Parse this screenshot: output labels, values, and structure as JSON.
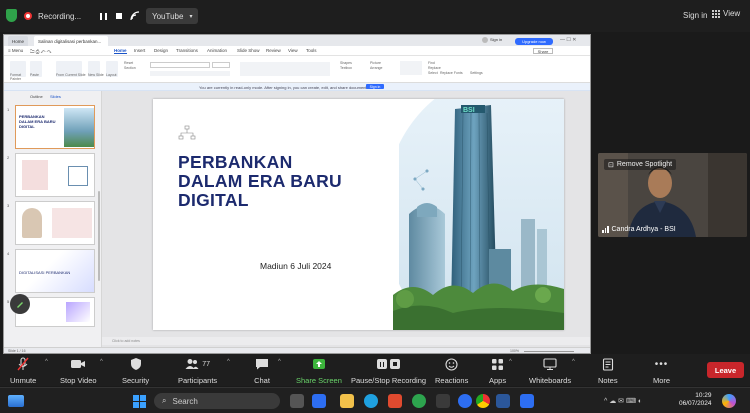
{
  "topbar": {
    "recording_label": "Recording...",
    "youtube_label": "YouTube",
    "signin_label": "Sign in",
    "view_label": "View"
  },
  "wps": {
    "tabs": [
      {
        "label": "Home"
      },
      {
        "label": "Salinan digitalisasi perbankan..."
      }
    ],
    "signin_label": "Sign in",
    "upgrade_label": "Upgrade now",
    "share_label": "Share",
    "menu": {
      "menu_label": "Menu",
      "items": [
        "Home",
        "Insert",
        "Design",
        "Transitions",
        "Animation",
        "Slide Show",
        "Review",
        "View",
        "Tools"
      ],
      "active": "Home"
    },
    "ribbon": {
      "format_painter": "Format Painter",
      "paste": "Paste",
      "from_current_slide": "From Current Slide",
      "new_slide": "New Slide",
      "layout": "Layout",
      "reset": "Reset",
      "section": "Section",
      "shapes": "Shapes",
      "picture": "Picture",
      "textbox": "Textbox",
      "arrange": "Arrange",
      "find": "Find",
      "replace": "Replace",
      "select": "Select",
      "replace_fonts": "Replace Fonts",
      "settings": "Settings"
    },
    "readonly_notice": "You are currently in read-only mode. After signing in, you can create, edit, and share documents.",
    "readonly_signin": "Sign in",
    "panel_tabs": [
      "Outline",
      "Slides"
    ],
    "thumbnails": [
      {
        "num": "1",
        "text": "PERBANKAN DALAM ERA BARU DIGITAL"
      },
      {
        "num": "2",
        "text": ""
      },
      {
        "num": "3",
        "text": ""
      },
      {
        "num": "4",
        "text": "DIGITALISASI PERBANKAN"
      },
      {
        "num": "5",
        "text": ""
      }
    ],
    "slide": {
      "title_line1": "PERBANKAN",
      "title_line2": "DALAM ERA BARU",
      "title_line3": "DIGITAL",
      "date": "Madiun 6 Juli 2024",
      "building_sign": "BSI"
    },
    "notes_placeholder": "Click to add notes",
    "status": {
      "slide_counter": "Slide 1 / 16",
      "zoom": "100%"
    }
  },
  "video": {
    "spotlight_label": "Remove Spotlight",
    "participant_name": "Candra Ardhya - BSI"
  },
  "controls": [
    {
      "label": "Unmute",
      "icon": "mic-muted-icon"
    },
    {
      "label": "Stop Video",
      "icon": "camera-icon"
    },
    {
      "label": "Security",
      "icon": "shield-icon"
    },
    {
      "label": "Participants",
      "icon": "participants-icon",
      "count": "77"
    },
    {
      "label": "Chat",
      "icon": "chat-icon"
    },
    {
      "label": "Share Screen",
      "icon": "share-screen-icon"
    },
    {
      "label": "Pause/Stop Recording",
      "icon": "recording-icon"
    },
    {
      "label": "Reactions",
      "icon": "reactions-icon"
    },
    {
      "label": "Apps",
      "icon": "apps-icon"
    },
    {
      "label": "Whiteboards",
      "icon": "whiteboard-icon"
    },
    {
      "label": "Notes",
      "icon": "notes-icon"
    },
    {
      "label": "More",
      "icon": "more-icon"
    }
  ],
  "leave_label": "Leave",
  "taskbar": {
    "search_placeholder": "Search",
    "time": "10:29",
    "date": "06/07/2024"
  },
  "colors": {
    "slide_title": "#1c2a6e",
    "leave": "#c8262b",
    "share_screen": "#6ad46a",
    "accent_blue": "#2f6bff"
  }
}
